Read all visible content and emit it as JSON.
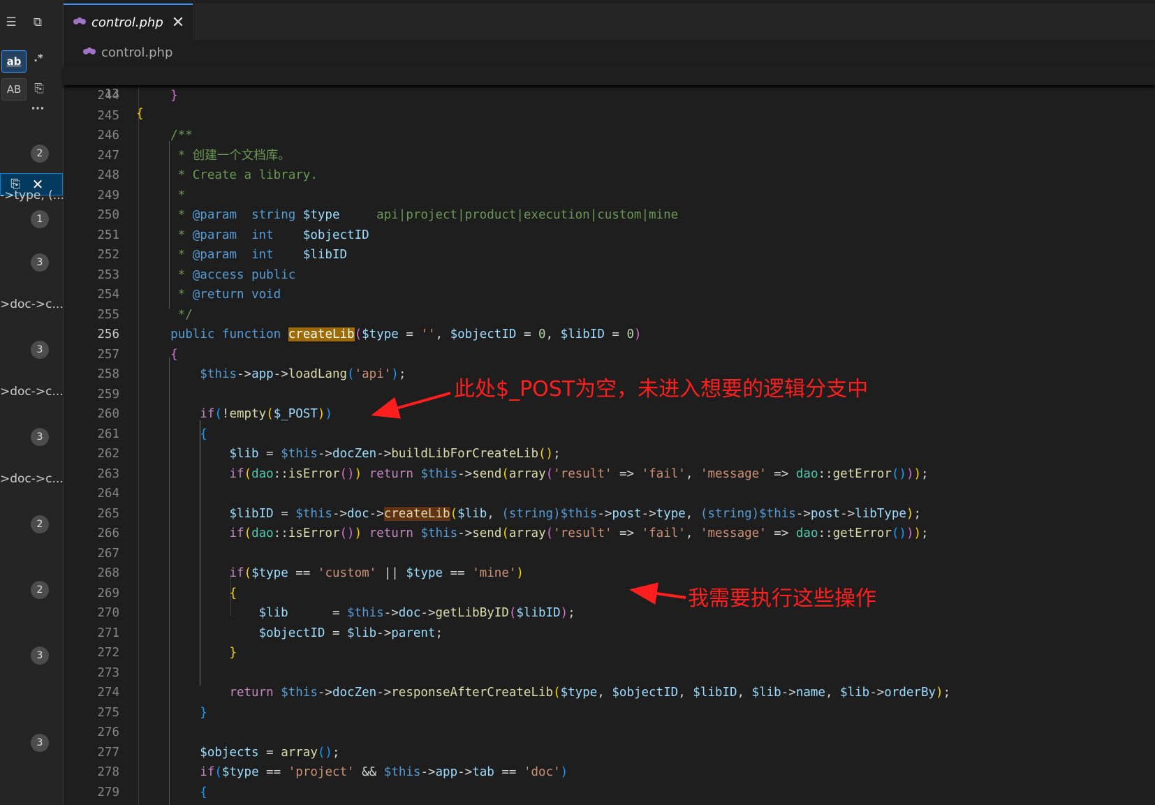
{
  "left_panel": {
    "toggle_regex_label": "ab",
    "toggle_regex2_label": ".*",
    "preserve_case_label": "AB",
    "more_label": "···",
    "results": [
      {
        "text": "",
        "badge": "2"
      },
      {
        "text": "->type, (...",
        "badge": "1"
      },
      {
        "text": "",
        "badge": "3"
      },
      {
        "text": ">doc->c...",
        "badge": "3"
      },
      {
        "text": ">doc->c...",
        "badge": "3"
      },
      {
        "text": ">doc->c...",
        "badge": "2"
      },
      {
        "text": "",
        "badge": "2"
      },
      {
        "text": "",
        "badge": "3"
      },
      {
        "text": "",
        "badge": "3"
      }
    ]
  },
  "tab": {
    "label": "control.php",
    "close": "✕"
  },
  "breadcrumb": {
    "file": "control.php"
  },
  "sticky": {
    "line_no": "13",
    "text": "{"
  },
  "editor": {
    "current_line": "256",
    "lines": [
      {
        "no": "244",
        "tokens": [
          [
            "    ",
            "pl"
          ],
          [
            "}",
            "b2"
          ]
        ]
      },
      {
        "no": "245",
        "tokens": []
      },
      {
        "no": "246",
        "tokens": [
          [
            "    /**",
            "cmt"
          ]
        ]
      },
      {
        "no": "247",
        "tokens": [
          [
            "     * 创建一个文档库。",
            "cmt"
          ]
        ]
      },
      {
        "no": "248",
        "tokens": [
          [
            "     * Create a library.",
            "cmt"
          ]
        ]
      },
      {
        "no": "249",
        "tokens": [
          [
            "     *",
            "cmt"
          ]
        ]
      },
      {
        "no": "250",
        "tokens": [
          [
            "     * ",
            "cmt"
          ],
          [
            "@param",
            "kw"
          ],
          [
            "  ",
            "cmt"
          ],
          [
            "string",
            "kw"
          ],
          [
            " $type",
            "var"
          ],
          [
            "     api|project|product|execution|custom|mine",
            "cmt"
          ]
        ]
      },
      {
        "no": "251",
        "tokens": [
          [
            "     * ",
            "cmt"
          ],
          [
            "@param",
            "kw"
          ],
          [
            "  ",
            "cmt"
          ],
          [
            "int",
            "kw"
          ],
          [
            "    $objectID",
            "var"
          ]
        ]
      },
      {
        "no": "252",
        "tokens": [
          [
            "     * ",
            "cmt"
          ],
          [
            "@param",
            "kw"
          ],
          [
            "  ",
            "cmt"
          ],
          [
            "int",
            "kw"
          ],
          [
            "    $libID",
            "var"
          ]
        ]
      },
      {
        "no": "253",
        "tokens": [
          [
            "     * ",
            "cmt"
          ],
          [
            "@access",
            "kw"
          ],
          [
            " ",
            "cmt"
          ],
          [
            "public",
            "kw"
          ]
        ]
      },
      {
        "no": "254",
        "tokens": [
          [
            "     * ",
            "cmt"
          ],
          [
            "@return",
            "kw"
          ],
          [
            " ",
            "cmt"
          ],
          [
            "void",
            "kw"
          ]
        ]
      },
      {
        "no": "255",
        "tokens": [
          [
            "     */",
            "cmt"
          ]
        ]
      },
      {
        "no": "256",
        "tokens": [
          [
            "    ",
            "pl"
          ],
          [
            "public",
            "kw"
          ],
          [
            " ",
            "pl"
          ],
          [
            "function",
            "kw"
          ],
          [
            " ",
            "pl"
          ],
          [
            "createLib",
            "hl"
          ],
          [
            "(",
            "b2"
          ],
          [
            "$type",
            "var"
          ],
          [
            " = ",
            "op"
          ],
          [
            "''",
            "str"
          ],
          [
            ", ",
            "pl"
          ],
          [
            "$objectID",
            "var"
          ],
          [
            " = ",
            "op"
          ],
          [
            "0",
            "num"
          ],
          [
            ", ",
            "pl"
          ],
          [
            "$libID",
            "var"
          ],
          [
            " = ",
            "op"
          ],
          [
            "0",
            "num"
          ],
          [
            ")",
            "b2"
          ]
        ]
      },
      {
        "no": "257",
        "tokens": [
          [
            "    ",
            "pl"
          ],
          [
            "{",
            "b2"
          ]
        ]
      },
      {
        "no": "258",
        "tokens": [
          [
            "        ",
            "pl"
          ],
          [
            "$this",
            "thisv"
          ],
          [
            "->",
            "op"
          ],
          [
            "app",
            "var"
          ],
          [
            "->",
            "op"
          ],
          [
            "loadLang",
            "fn"
          ],
          [
            "(",
            "b3"
          ],
          [
            "'api'",
            "str"
          ],
          [
            ")",
            "b3"
          ],
          [
            ";",
            "pl"
          ]
        ]
      },
      {
        "no": "259",
        "tokens": []
      },
      {
        "no": "260",
        "tokens": [
          [
            "        ",
            "pl"
          ],
          [
            "if",
            "ctl"
          ],
          [
            "(",
            "b3"
          ],
          [
            "!",
            "op"
          ],
          [
            "empty",
            "fn"
          ],
          [
            "(",
            "b1"
          ],
          [
            "$_POST",
            "var"
          ],
          [
            ")",
            "b1"
          ],
          [
            ")",
            "b3"
          ]
        ]
      },
      {
        "no": "261",
        "tokens": [
          [
            "        ",
            "pl"
          ],
          [
            "{",
            "b3"
          ]
        ]
      },
      {
        "no": "262",
        "tokens": [
          [
            "            ",
            "pl"
          ],
          [
            "$lib",
            "var"
          ],
          [
            " = ",
            "op"
          ],
          [
            "$this",
            "thisv"
          ],
          [
            "->",
            "op"
          ],
          [
            "docZen",
            "var"
          ],
          [
            "->",
            "op"
          ],
          [
            "buildLibForCreateLib",
            "fn"
          ],
          [
            "()",
            "b1"
          ],
          [
            ";",
            "pl"
          ]
        ]
      },
      {
        "no": "263",
        "tokens": [
          [
            "            ",
            "pl"
          ],
          [
            "if",
            "ctl"
          ],
          [
            "(",
            "b1"
          ],
          [
            "dao",
            "cls"
          ],
          [
            "::",
            "op"
          ],
          [
            "isError",
            "fn"
          ],
          [
            "()",
            "b2"
          ],
          [
            ")",
            "b1"
          ],
          [
            " ",
            "pl"
          ],
          [
            "return",
            "ctl"
          ],
          [
            " ",
            "pl"
          ],
          [
            "$this",
            "thisv"
          ],
          [
            "->",
            "op"
          ],
          [
            "send",
            "fn"
          ],
          [
            "(",
            "b1"
          ],
          [
            "array",
            "fn"
          ],
          [
            "(",
            "b2"
          ],
          [
            "'result'",
            "str"
          ],
          [
            " => ",
            "op"
          ],
          [
            "'fail'",
            "str"
          ],
          [
            ", ",
            "pl"
          ],
          [
            "'message'",
            "str"
          ],
          [
            " => ",
            "op"
          ],
          [
            "dao",
            "cls"
          ],
          [
            "::",
            "op"
          ],
          [
            "getError",
            "fn"
          ],
          [
            "()",
            "b3"
          ],
          [
            ")",
            "b2"
          ],
          [
            ")",
            "b1"
          ],
          [
            ";",
            "pl"
          ]
        ]
      },
      {
        "no": "264",
        "tokens": []
      },
      {
        "no": "265",
        "tokens": [
          [
            "            ",
            "pl"
          ],
          [
            "$libID",
            "var"
          ],
          [
            " = ",
            "op"
          ],
          [
            "$this",
            "thisv"
          ],
          [
            "->",
            "op"
          ],
          [
            "doc",
            "var"
          ],
          [
            "->",
            "op"
          ],
          [
            "createLib",
            "fn hl2"
          ],
          [
            "(",
            "b1"
          ],
          [
            "$lib",
            "var"
          ],
          [
            ", ",
            "pl"
          ],
          [
            "(string)",
            "kw"
          ],
          [
            "$this",
            "thisv"
          ],
          [
            "->",
            "op"
          ],
          [
            "post",
            "var"
          ],
          [
            "->",
            "op"
          ],
          [
            "type",
            "var"
          ],
          [
            ", ",
            "pl"
          ],
          [
            "(string)",
            "kw"
          ],
          [
            "$this",
            "thisv"
          ],
          [
            "->",
            "op"
          ],
          [
            "post",
            "var"
          ],
          [
            "->",
            "op"
          ],
          [
            "libType",
            "var"
          ],
          [
            ")",
            "b1"
          ],
          [
            ";",
            "pl"
          ]
        ]
      },
      {
        "no": "266",
        "tokens": [
          [
            "            ",
            "pl"
          ],
          [
            "if",
            "ctl"
          ],
          [
            "(",
            "b1"
          ],
          [
            "dao",
            "cls"
          ],
          [
            "::",
            "op"
          ],
          [
            "isError",
            "fn"
          ],
          [
            "()",
            "b2"
          ],
          [
            ")",
            "b1"
          ],
          [
            " ",
            "pl"
          ],
          [
            "return",
            "ctl"
          ],
          [
            " ",
            "pl"
          ],
          [
            "$this",
            "thisv"
          ],
          [
            "->",
            "op"
          ],
          [
            "send",
            "fn"
          ],
          [
            "(",
            "b1"
          ],
          [
            "array",
            "fn"
          ],
          [
            "(",
            "b2"
          ],
          [
            "'result'",
            "str"
          ],
          [
            " => ",
            "op"
          ],
          [
            "'fail'",
            "str"
          ],
          [
            ", ",
            "pl"
          ],
          [
            "'message'",
            "str"
          ],
          [
            " => ",
            "op"
          ],
          [
            "dao",
            "cls"
          ],
          [
            "::",
            "op"
          ],
          [
            "getError",
            "fn"
          ],
          [
            "()",
            "b3"
          ],
          [
            ")",
            "b2"
          ],
          [
            ")",
            "b1"
          ],
          [
            ";",
            "pl"
          ]
        ]
      },
      {
        "no": "267",
        "tokens": []
      },
      {
        "no": "268",
        "tokens": [
          [
            "            ",
            "pl"
          ],
          [
            "if",
            "ctl"
          ],
          [
            "(",
            "b1"
          ],
          [
            "$type",
            "var"
          ],
          [
            " == ",
            "op"
          ],
          [
            "'custom'",
            "str"
          ],
          [
            " || ",
            "op"
          ],
          [
            "$type",
            "var"
          ],
          [
            " == ",
            "op"
          ],
          [
            "'mine'",
            "str"
          ],
          [
            ")",
            "b1"
          ]
        ]
      },
      {
        "no": "269",
        "tokens": [
          [
            "            ",
            "pl"
          ],
          [
            "{",
            "b1"
          ]
        ]
      },
      {
        "no": "270",
        "tokens": [
          [
            "                ",
            "pl"
          ],
          [
            "$lib",
            "var"
          ],
          [
            "      = ",
            "op"
          ],
          [
            "$this",
            "thisv"
          ],
          [
            "->",
            "op"
          ],
          [
            "doc",
            "var"
          ],
          [
            "->",
            "op"
          ],
          [
            "getLibByID",
            "fn"
          ],
          [
            "(",
            "b2"
          ],
          [
            "$libID",
            "var"
          ],
          [
            ")",
            "b2"
          ],
          [
            ";",
            "pl"
          ]
        ]
      },
      {
        "no": "271",
        "tokens": [
          [
            "                ",
            "pl"
          ],
          [
            "$objectID",
            "var"
          ],
          [
            " = ",
            "op"
          ],
          [
            "$lib",
            "var"
          ],
          [
            "->",
            "op"
          ],
          [
            "parent",
            "var"
          ],
          [
            ";",
            "pl"
          ]
        ]
      },
      {
        "no": "272",
        "tokens": [
          [
            "            ",
            "pl"
          ],
          [
            "}",
            "b1"
          ]
        ]
      },
      {
        "no": "273",
        "tokens": []
      },
      {
        "no": "274",
        "tokens": [
          [
            "            ",
            "pl"
          ],
          [
            "return",
            "ctl"
          ],
          [
            " ",
            "pl"
          ],
          [
            "$this",
            "thisv"
          ],
          [
            "->",
            "op"
          ],
          [
            "docZen",
            "var"
          ],
          [
            "->",
            "op"
          ],
          [
            "responseAfterCreateLib",
            "fn"
          ],
          [
            "(",
            "b1"
          ],
          [
            "$type",
            "var"
          ],
          [
            ", ",
            "pl"
          ],
          [
            "$objectID",
            "var"
          ],
          [
            ", ",
            "pl"
          ],
          [
            "$libID",
            "var"
          ],
          [
            ", ",
            "pl"
          ],
          [
            "$lib",
            "var"
          ],
          [
            "->",
            "op"
          ],
          [
            "name",
            "var"
          ],
          [
            ", ",
            "pl"
          ],
          [
            "$lib",
            "var"
          ],
          [
            "->",
            "op"
          ],
          [
            "orderBy",
            "var"
          ],
          [
            ")",
            "b1"
          ],
          [
            ";",
            "pl"
          ]
        ]
      },
      {
        "no": "275",
        "tokens": [
          [
            "        ",
            "pl"
          ],
          [
            "}",
            "b3"
          ]
        ]
      },
      {
        "no": "276",
        "tokens": []
      },
      {
        "no": "277",
        "tokens": [
          [
            "        ",
            "pl"
          ],
          [
            "$objects",
            "var"
          ],
          [
            " = ",
            "op"
          ],
          [
            "array",
            "fn"
          ],
          [
            "()",
            "b3"
          ],
          [
            ";",
            "pl"
          ]
        ]
      },
      {
        "no": "278",
        "tokens": [
          [
            "        ",
            "pl"
          ],
          [
            "if",
            "ctl"
          ],
          [
            "(",
            "b3"
          ],
          [
            "$type",
            "var"
          ],
          [
            " == ",
            "op"
          ],
          [
            "'project'",
            "str"
          ],
          [
            " && ",
            "op"
          ],
          [
            "$this",
            "thisv"
          ],
          [
            "->",
            "op"
          ],
          [
            "app",
            "var"
          ],
          [
            "->",
            "op"
          ],
          [
            "tab",
            "var"
          ],
          [
            " == ",
            "op"
          ],
          [
            "'doc'",
            "str"
          ],
          [
            ")",
            "b3"
          ]
        ]
      },
      {
        "no": "279",
        "tokens": [
          [
            "        ",
            "pl"
          ],
          [
            "{",
            "b3"
          ]
        ]
      }
    ]
  },
  "annotations": {
    "note1": "此处$_POST为空，未进入想要的逻辑分支中",
    "note2": "我需要执行这些操作",
    "color": "#ff1e1e"
  }
}
